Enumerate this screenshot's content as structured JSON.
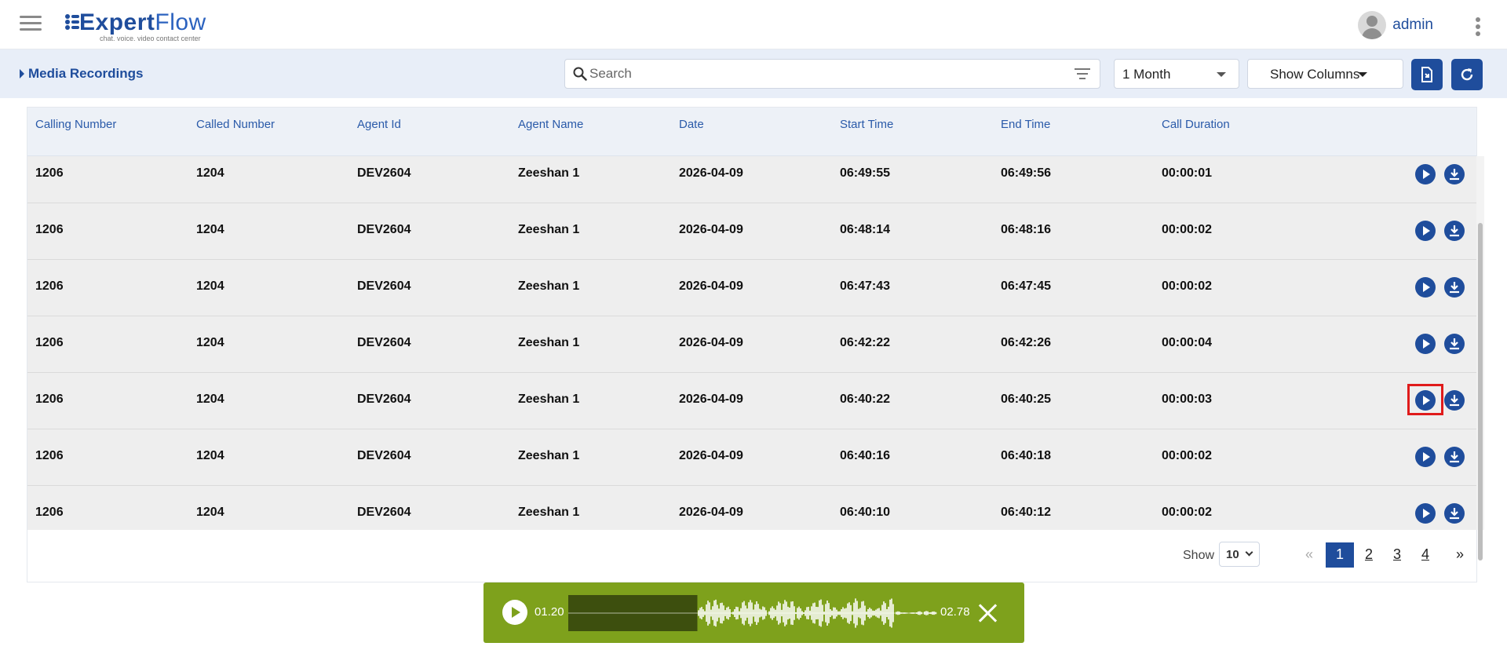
{
  "header": {
    "logo_prefix": "Expert",
    "logo_suffix": "Flow",
    "logo_tagline": "chat. voice. video contact center",
    "username": "admin"
  },
  "toolbar": {
    "title": "Media Recordings",
    "search_placeholder": "Search",
    "period": "1 Month",
    "show_columns": "Show Columns"
  },
  "table": {
    "columns": [
      "Calling Number",
      "Called Number",
      "Agent Id",
      "Agent Name",
      "Date",
      "Start Time",
      "End Time",
      "Call Duration"
    ],
    "rows": [
      [
        "1206",
        "1204",
        "DEV2604",
        "Zeeshan 1",
        "2026-04-09",
        "06:49:55",
        "06:49:56",
        "00:00:01"
      ],
      [
        "1206",
        "1204",
        "DEV2604",
        "Zeeshan 1",
        "2026-04-09",
        "06:48:14",
        "06:48:16",
        "00:00:02"
      ],
      [
        "1206",
        "1204",
        "DEV2604",
        "Zeeshan 1",
        "2026-04-09",
        "06:47:43",
        "06:47:45",
        "00:00:02"
      ],
      [
        "1206",
        "1204",
        "DEV2604",
        "Zeeshan 1",
        "2026-04-09",
        "06:42:22",
        "06:42:26",
        "00:00:04"
      ],
      [
        "1206",
        "1204",
        "DEV2604",
        "Zeeshan 1",
        "2026-04-09",
        "06:40:22",
        "06:40:25",
        "00:00:03"
      ],
      [
        "1206",
        "1204",
        "DEV2604",
        "Zeeshan 1",
        "2026-04-09",
        "06:40:16",
        "06:40:18",
        "00:00:02"
      ],
      [
        "1206",
        "1204",
        "DEV2604",
        "Zeeshan 1",
        "2026-04-09",
        "06:40:10",
        "06:40:12",
        "00:00:02"
      ]
    ],
    "highlighted_row": 4
  },
  "pagination": {
    "show_label": "Show",
    "page_size": "10",
    "prev": "«",
    "pages": [
      "1",
      "2",
      "3",
      "4"
    ],
    "active_page": "1",
    "next": "»"
  },
  "player": {
    "current_time": "01.20",
    "end_time": "02.78",
    "progress_fraction": 0.35,
    "background_color": "#7ea11c"
  },
  "colors": {
    "primary": "#1f4d9c",
    "highlight": "#e01b1b"
  }
}
